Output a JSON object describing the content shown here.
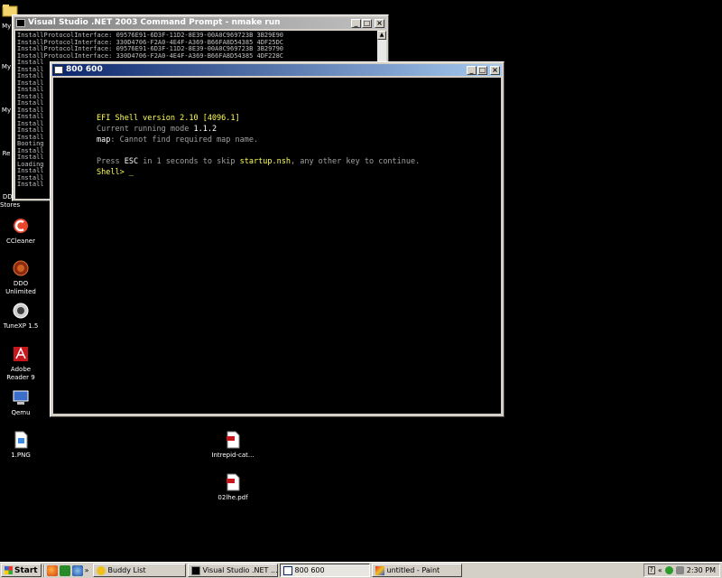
{
  "desktop_icons": [
    {
      "label": "My D",
      "icon": "folder-icon"
    },
    {
      "label": "My",
      "icon": "computer-icon"
    },
    {
      "label": "My",
      "icon": "network-icon"
    },
    {
      "label": "Re",
      "icon": "recycle-bin-icon"
    },
    {
      "label": "DDO Stores",
      "icon": "ddo-stores-icon"
    },
    {
      "label": "CCleaner",
      "icon": "ccleaner-icon"
    },
    {
      "label": "DDO Unlimited",
      "icon": "ddo-icon"
    },
    {
      "label": "TuneXP 1.5",
      "icon": "tunexp-icon"
    },
    {
      "label": "Adobe Reader 9",
      "icon": "adobe-reader-icon"
    },
    {
      "label": "Qemu",
      "icon": "qemu-icon"
    },
    {
      "label": "1.PNG",
      "icon": "png-file-icon"
    },
    {
      "label": "Intrepid-cat...",
      "icon": "pdf-file-icon"
    },
    {
      "label": "02lhe.pdf",
      "icon": "pdf-file-icon"
    }
  ],
  "cmd_window": {
    "title": "Visual Studio .NET 2003 Command Prompt - nmake run",
    "lines": [
      "InstallProtocolInterface: 09576E91-6D3F-11D2-8E39-00A0C969723B 3B29E90",
      "InstallProtocolInterface: 330D4706-F2A0-4E4F-A369-B66FA8D54385 4DF25DC",
      "InstallProtocolInterface: 09576E91-6D3F-11D2-8E39-00A0C969723B 3B29790",
      "InstallProtocolInterface: 330D4706-F2A0-4E4F-A369-B66FA8D54385 4DF228C",
      "Install",
      "Install",
      "Install",
      "Install",
      "Install",
      "Install",
      "Install",
      "Install",
      "Install",
      "Install",
      "Install",
      "Install",
      "Booting",
      "Install",
      "Install",
      "Loading",
      "Install",
      "Install",
      "Install"
    ]
  },
  "efi_window": {
    "title": "800 600",
    "version_line": "EFI Shell version 2.10 [4096.1]",
    "mode_label": "Current running mode ",
    "mode_value": "1.1.2",
    "map_key": "map",
    "map_msg": ": Cannot find required map name.",
    "press_a": "Press ",
    "esc_key": "ESC",
    "press_b": " in 1 seconds to skip ",
    "startup_file": "startup.nsh",
    "press_c": ", any other key to continue.",
    "prompt": "Shell> _"
  },
  "taskbar": {
    "start_label": "Start",
    "overflow": "»",
    "tasks": [
      {
        "label": "Buddy List",
        "icon": "buddy-list-icon"
      },
      {
        "label": "Visual Studio .NET ...",
        "icon": "cmd-icon"
      },
      {
        "label": "800 600",
        "icon": "window-icon"
      },
      {
        "label": "untitled - Paint",
        "icon": "paint-icon"
      }
    ],
    "tray_collapse": "«",
    "clock": "2:30 PM"
  },
  "window_buttons": {
    "minimize": "_",
    "maximize": "□",
    "close": "×"
  }
}
